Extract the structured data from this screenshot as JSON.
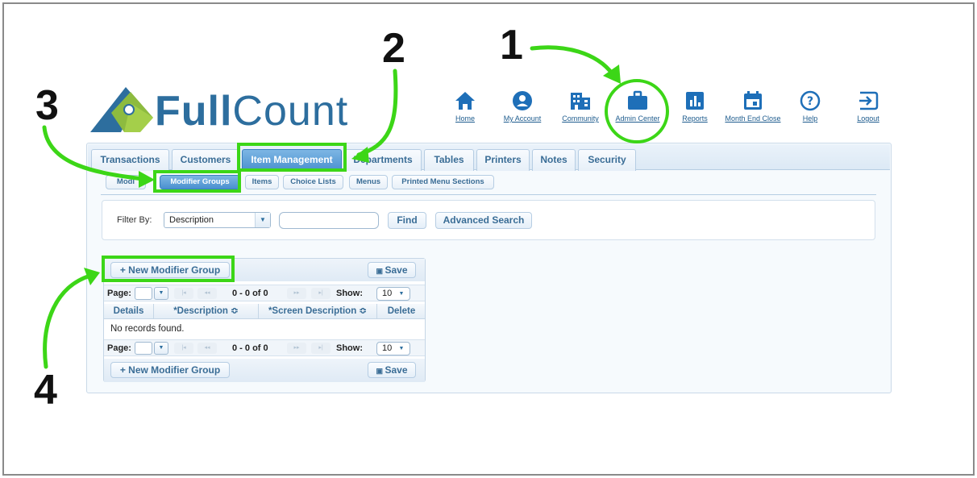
{
  "logo": {
    "part1": "Full",
    "part2": "Count"
  },
  "topnav": {
    "items": [
      {
        "label": "Home",
        "icon": "home-icon"
      },
      {
        "label": "My Account",
        "icon": "account-icon"
      },
      {
        "label": "Community",
        "icon": "building-icon"
      },
      {
        "label": "Admin Center",
        "icon": "briefcase-icon"
      },
      {
        "label": "Reports",
        "icon": "chart-icon"
      },
      {
        "label": "Month End Close",
        "icon": "calendar-icon"
      },
      {
        "label": "Help",
        "icon": "help-icon"
      },
      {
        "label": "Logout",
        "icon": "logout-icon"
      }
    ]
  },
  "tabs": [
    "Transactions",
    "Customers",
    "Item Management",
    "Departments",
    "Tables",
    "Printers",
    "Notes",
    "Security"
  ],
  "active_tab": "Item Management",
  "subtabs": [
    "Modi",
    "Modifier Groups",
    "Items",
    "Choice Lists",
    "Menus",
    "Printed Menu Sections"
  ],
  "active_subtab": "Modifier Groups",
  "filter": {
    "label": "Filter By:",
    "selected": "Description",
    "find_label": "Find",
    "advanced_label": "Advanced Search"
  },
  "grid": {
    "new_button": "+ New Modifier Group",
    "save_button": "Save",
    "pager": {
      "page_label": "Page:",
      "range_text": "0 - 0 of 0",
      "show_label": "Show:",
      "show_value": "10"
    },
    "columns": [
      "Details",
      "*Description ≎",
      "*Screen Description ≎",
      "Delete"
    ],
    "empty_text": "No records found."
  },
  "annotations": [
    "1",
    "2",
    "3",
    "4"
  ],
  "colors": {
    "highlight": "#3cd617",
    "brand": "#2d6e9e",
    "accent": "#4a90cf"
  }
}
